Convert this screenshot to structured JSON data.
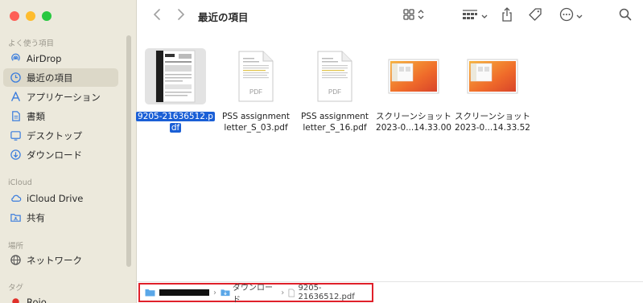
{
  "sidebar": {
    "favorites_header": "よく使う項目",
    "favorites": [
      {
        "label": "AirDrop",
        "icon": "airdrop-icon"
      },
      {
        "label": "最近の項目",
        "icon": "recents-icon",
        "selected": true
      },
      {
        "label": "アプリケーション",
        "icon": "applications-icon"
      },
      {
        "label": "書類",
        "icon": "documents-icon"
      },
      {
        "label": "デスクトップ",
        "icon": "desktop-icon"
      },
      {
        "label": "ダウンロード",
        "icon": "downloads-icon"
      }
    ],
    "icloud_header": "iCloud",
    "icloud": [
      {
        "label": "iCloud Drive",
        "icon": "icloud-icon"
      },
      {
        "label": "共有",
        "icon": "shared-folder-icon"
      }
    ],
    "locations_header": "場所",
    "locations": [
      {
        "label": "ネットワーク",
        "icon": "network-icon"
      }
    ],
    "tags_header": "タグ",
    "tags": [
      {
        "label": "Rojo",
        "color": "#e0302a"
      }
    ]
  },
  "toolbar": {
    "title": "最近の項目"
  },
  "files": [
    {
      "line1": "9205-21636512.p",
      "line2": "df",
      "kind": "pdf-doc",
      "selected": true
    },
    {
      "line1": "PSS assignment",
      "line2": "letter_S_03.pdf",
      "kind": "pdf",
      "badge": "PDF"
    },
    {
      "line1": "PSS assignment",
      "line2": "letter_S_16.pdf",
      "kind": "pdf",
      "badge": "PDF"
    },
    {
      "line1": "スクリーンショット",
      "line2": "2023-0...14.33.00",
      "kind": "screenshot"
    },
    {
      "line1": "スクリーンショット",
      "line2": "2023-0...14.33.52",
      "kind": "screenshot"
    }
  ],
  "pathbar": {
    "folder": "ダウンロード",
    "file": "9205-21636512.pdf"
  },
  "colors": {
    "accent": "#1a5fd6",
    "highlight_border": "#e0202a",
    "sidebar_bg": "#ece9dc"
  }
}
